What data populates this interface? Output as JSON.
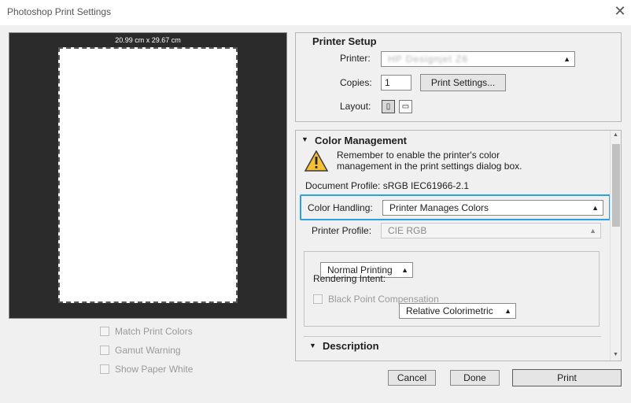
{
  "window": {
    "title": "Photoshop Print Settings",
    "close_glyph": "✕"
  },
  "preview": {
    "paper_size": "20.99 cm x 29.67 cm",
    "options": [
      {
        "label": "Match Print Colors",
        "checked": false
      },
      {
        "label": "Gamut Warning",
        "checked": false
      },
      {
        "label": "Show Paper White",
        "checked": false
      }
    ]
  },
  "printer_setup": {
    "title": "Printer Setup",
    "printer_label": "Printer:",
    "printer_value": "HP Designjet Z6",
    "copies_label": "Copies:",
    "copies_value": "1",
    "print_settings_button": "Print Settings...",
    "layout_label": "Layout:",
    "layout_icons": [
      "portrait-layout-icon",
      "landscape-layout-icon"
    ]
  },
  "color_management": {
    "title": "Color Management",
    "collapse_glyph": "▼",
    "warning_icon": "warning-icon",
    "warning_line1": "Remember to enable the printer's color",
    "warning_line2": "management in the print settings dialog box.",
    "document_profile": "Document Profile: sRGB IEC61966-2.1",
    "color_handling_label": "Color Handling:",
    "color_handling_value": "Printer Manages Colors",
    "printer_profile_label": "Printer Profile:",
    "printer_profile_value": "CIE RGB",
    "normal_printing_value": "Normal Printing",
    "rendering_intent_label": "Rendering Intent:",
    "rendering_intent_value": "Relative Colorimetric",
    "black_point_label": "Black Point Compensation",
    "black_point_checked": false
  },
  "description": {
    "title": "Description",
    "collapse_glyph": "▼"
  },
  "buttons": {
    "cancel": "Cancel",
    "done": "Done",
    "print": "Print"
  },
  "colors": {
    "highlight": "#2d9fe6",
    "preview_bg": "#2b2b2b"
  }
}
